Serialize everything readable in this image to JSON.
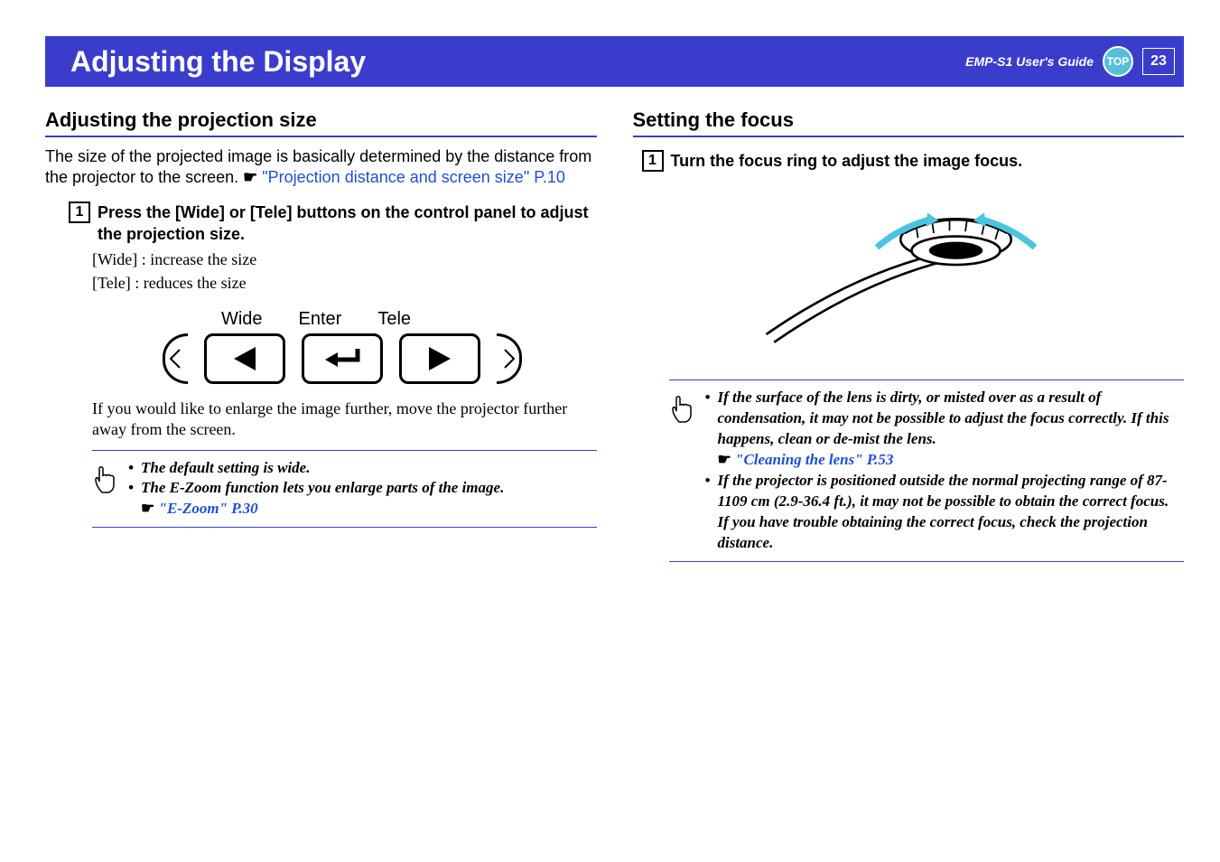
{
  "header": {
    "title": "Adjusting the Display",
    "guide_label": "EMP-S1 User's Guide",
    "top_label": "TOP",
    "page_number": "23"
  },
  "left": {
    "section_title": "Adjusting the projection size",
    "intro_text": "The size of the projected image is basically determined by the distance from the projector to the screen. ",
    "intro_link": "\"Projection distance and screen size\" P.10",
    "step1_num": "1",
    "step1_title": "Press the [Wide] or [Tele] buttons on the control panel to adjust the projection size.",
    "step1_line1": "[Wide] : increase the size",
    "step1_line2": "[Tele] :   reduces the size",
    "labels": {
      "wide": "Wide",
      "enter": "Enter",
      "tele": "Tele"
    },
    "further_text": "If you would like to enlarge the image further, move the projector further away from the screen.",
    "tip1": "The default setting is wide.",
    "tip2": "The E-Zoom function lets you enlarge parts of the image.",
    "tip2_link": "\"E-Zoom\" P.30"
  },
  "right": {
    "section_title": "Setting the focus",
    "step1_num": "1",
    "step1_title": "Turn the focus ring to adjust the image focus.",
    "tip1": "If the surface of the lens is dirty, or misted over as a result of condensation, it may not be possible to adjust the focus correctly. If this happens, clean or de-mist the lens.",
    "tip1_link": "\"Cleaning the lens\" P.53",
    "tip2": "If the projector is positioned outside the normal projecting range of 87-1109 cm (2.9-36.4 ft.), it may not be possible to obtain the correct focus. If you have trouble obtaining the correct focus, check the projection distance."
  }
}
